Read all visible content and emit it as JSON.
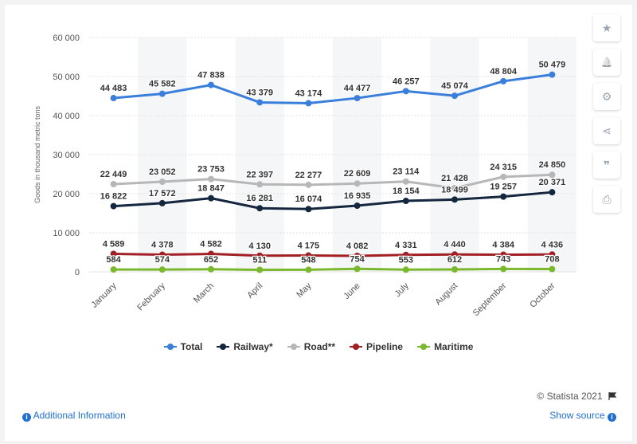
{
  "chart_data": {
    "type": "line",
    "categories": [
      "January",
      "February",
      "March",
      "April",
      "May",
      "June",
      "July",
      "August",
      "September",
      "October"
    ],
    "ylabel": "Goods in thousand metric tons",
    "ylim": [
      0,
      60000
    ],
    "yticks": [
      0,
      10000,
      20000,
      30000,
      40000,
      50000,
      60000
    ],
    "ytick_labels": [
      "0",
      "10 000",
      "20 000",
      "30 000",
      "40 000",
      "50 000",
      "60 000"
    ],
    "grid": true,
    "legend_position": "bottom",
    "series": [
      {
        "name": "Total",
        "color": "#3a7fdb",
        "values": [
          44483,
          45582,
          47838,
          43379,
          43174,
          44477,
          46257,
          45074,
          48804,
          50479
        ],
        "labels": [
          "44 483",
          "45 582",
          "47 838",
          "43 379",
          "43 174",
          "44 477",
          "46 257",
          "45 074",
          "48 804",
          "50 479"
        ]
      },
      {
        "name": "Railway*",
        "color": "#15263f",
        "values": [
          16822,
          17572,
          18847,
          16281,
          16074,
          16935,
          18154,
          18499,
          19257,
          20371
        ],
        "labels": [
          "16 822",
          "17 572",
          "18 847",
          "16 281",
          "16 074",
          "16 935",
          "18 154",
          "18 499",
          "19 257",
          "20 371"
        ]
      },
      {
        "name": "Road**",
        "color": "#b7b7b7",
        "values": [
          22449,
          23052,
          23753,
          22397,
          22277,
          22609,
          23114,
          21428,
          24315,
          24850
        ],
        "labels": [
          "22 449",
          "23 052",
          "23 753",
          "22 397",
          "22 277",
          "22 609",
          "23 114",
          "21 428",
          "24 315",
          "24 850"
        ]
      },
      {
        "name": "Pipeline",
        "color": "#a21f23",
        "values": [
          4589,
          4378,
          4582,
          4130,
          4175,
          4082,
          4331,
          4440,
          4384,
          4436
        ],
        "labels": [
          "4 589",
          "4 378",
          "4 582",
          "4 130",
          "4 175",
          "4 082",
          "4 331",
          "4 440",
          "4 384",
          "4 436"
        ]
      },
      {
        "name": "Maritime",
        "color": "#7ab82e",
        "values": [
          584,
          574,
          652,
          511,
          548,
          754,
          553,
          612,
          743,
          708
        ],
        "labels": [
          "584",
          "574",
          "652",
          "511",
          "548",
          "754",
          "553",
          "612",
          "743",
          "708"
        ]
      }
    ]
  },
  "toolbar": {
    "icons": [
      "star-icon",
      "bell-icon",
      "gear-icon",
      "share-icon",
      "quote-icon",
      "print-icon"
    ],
    "glyphs": [
      "★",
      "🔔",
      "⚙",
      "⋖",
      "❞",
      "⎙"
    ]
  },
  "footer": {
    "additional_info": "Additional Information",
    "show_source": "Show source",
    "copyright": "© Statista 2021"
  },
  "colors": {
    "link": "#1f6fd0",
    "band": "#f5f6f8"
  }
}
